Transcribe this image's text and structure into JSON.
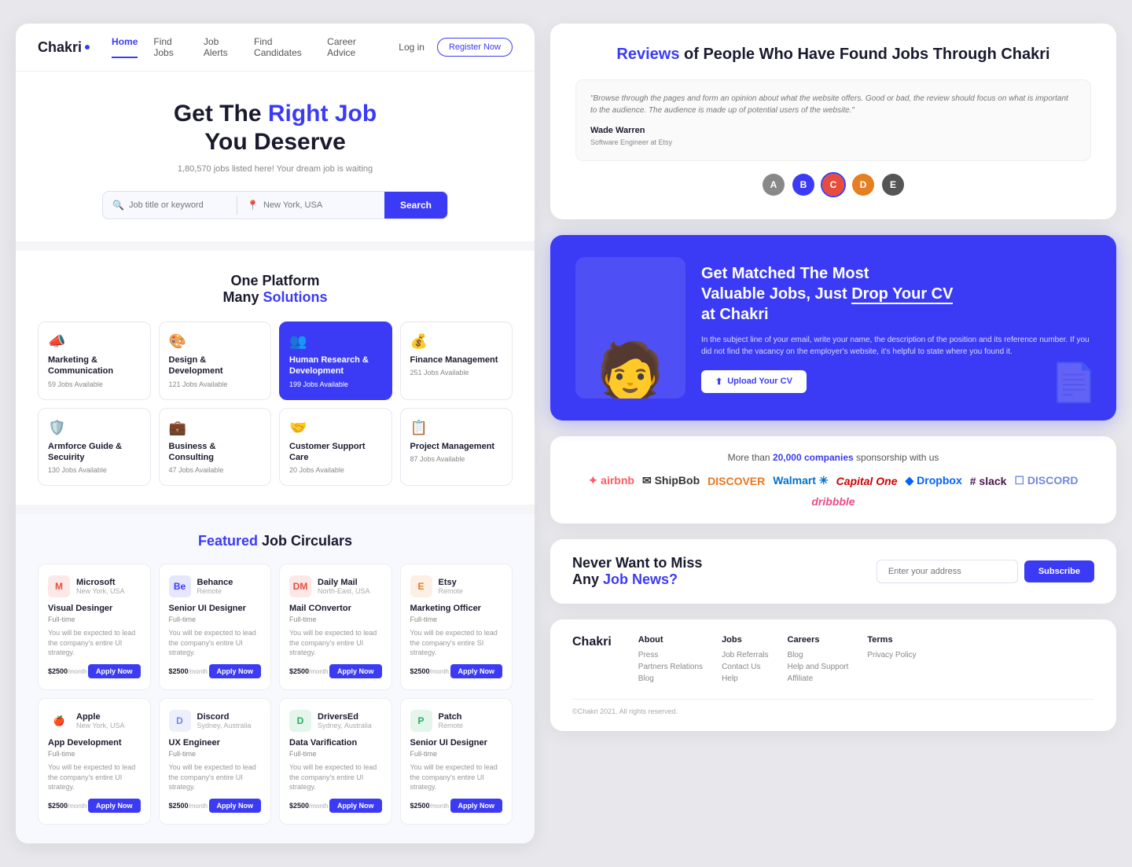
{
  "left": {
    "navbar": {
      "logo": "Chakri",
      "links": [
        {
          "label": "Home",
          "active": true
        },
        {
          "label": "Find Jobs"
        },
        {
          "label": "Job Alerts"
        },
        {
          "label": "Find Candidates"
        },
        {
          "label": "Career Advice"
        }
      ],
      "login": "Log in",
      "register": "Register Now"
    },
    "hero": {
      "title_plain": "Get The",
      "title_highlight": "Right Job",
      "title_end": "You Deserve",
      "subtitle": "1,80,570 jobs listed here! Your dream job is waiting",
      "search_placeholder": "Job title or keyword",
      "location_placeholder": "New York, USA",
      "search_btn": "Search"
    },
    "platform": {
      "title_plain": "One Platform",
      "title_sub_plain": "Many",
      "title_sub_highlight": "Solutions",
      "categories": [
        {
          "icon": "📣",
          "name": "Marketing & Communication",
          "jobs": "59 Jobs Available"
        },
        {
          "icon": "🎨",
          "name": "Design & Development",
          "jobs": "121 Jobs Available"
        },
        {
          "icon": "👥",
          "name": "Human Research & Development",
          "jobs": "199 Jobs Available",
          "active": true
        },
        {
          "icon": "💰",
          "name": "Finance Management",
          "jobs": "251 Jobs Available"
        },
        {
          "icon": "🛡️",
          "name": "Armforce Guide & Secuirity",
          "jobs": "130 Jobs Available"
        },
        {
          "icon": "💼",
          "name": "Business & Consulting",
          "jobs": "47 Jobs Available"
        },
        {
          "icon": "🤝",
          "name": "Customer Support Care",
          "jobs": "20 Jobs Available"
        },
        {
          "icon": "📋",
          "name": "Project Management",
          "jobs": "87 Jobs Available"
        }
      ]
    },
    "featured": {
      "title_highlight": "Featured",
      "title_plain": "Job Circulars",
      "jobs_row1": [
        {
          "company": "Microsoft",
          "location": "New York, USA",
          "logo_color": "#e74c3c",
          "logo_text": "M",
          "title": "Visual Desinger",
          "type": "Full-time",
          "desc": "You will be expected to lead the company's entire UI strategy.",
          "salary": "$2500",
          "salary_period": "/month"
        },
        {
          "company": "Behance",
          "location": "Remote",
          "logo_color": "#3b3bf5",
          "logo_text": "Be",
          "title": "Senior UI Designer",
          "type": "Full-time",
          "desc": "You will be expected to lead the company's entire UI strategy.",
          "salary": "$2500",
          "salary_period": "/month"
        },
        {
          "company": "Daily Mail",
          "location": "North-East, USA",
          "logo_color": "#e74c3c",
          "logo_text": "DM",
          "title": "Mail COnvertor",
          "type": "Full-time",
          "desc": "You will be expected to lead the company's entire UI strategy.",
          "salary": "$2500",
          "salary_period": "/month"
        },
        {
          "company": "Etsy",
          "location": "Remote",
          "logo_color": "#e67e22",
          "logo_text": "E",
          "title": "Marketing Officer",
          "type": "Full-time",
          "desc": "You will be expected to lead the company's entire SI strategy.",
          "salary": "$2500",
          "salary_period": "/month"
        }
      ],
      "jobs_row2": [
        {
          "company": "Apple",
          "location": "New York, USA",
          "logo_color": "#555",
          "logo_text": "🍎",
          "title": "App Development",
          "type": "Full-time",
          "desc": "You will be expected to lead the company's entire UI strategy.",
          "salary": "$2500",
          "salary_period": "/month"
        },
        {
          "company": "Discord",
          "location": "Sydney, Australia",
          "logo_color": "#7289da",
          "logo_text": "D",
          "title": "UX Engineer",
          "type": "Full-time",
          "desc": "You will be expected to lead the company's entire UI strategy.",
          "salary": "$2500",
          "salary_period": "/month"
        },
        {
          "company": "DriversEd",
          "location": "Sydney, Australia",
          "logo_color": "#27ae60",
          "logo_text": "D",
          "title": "Data Varification",
          "type": "Full-time",
          "desc": "You will be expected to lead the company's entire UI strategy.",
          "salary": "$2500",
          "salary_period": "/month"
        },
        {
          "company": "Patch",
          "location": "Remote",
          "logo_color": "#27ae60",
          "logo_text": "P",
          "title": "Senior UI Designer",
          "type": "Full-time",
          "desc": "You will be expected to lead the company's entire UI strategy.",
          "salary": "$2500",
          "salary_period": "/month"
        }
      ]
    }
  },
  "right": {
    "reviews": {
      "title_highlight": "Reviews",
      "title_plain": "of People Who Have Found Jobs Through Chakri",
      "review": {
        "quote": "\"Browse through the pages and form an opinion about what the website offers. Good or bad, the review should focus on what is important to the audience. The audience is made up of potential users of the website.\"",
        "name": "Wade Warren",
        "role": "Software Engineer at Etsy"
      },
      "avatars": [
        {
          "color": "#888",
          "text": "A"
        },
        {
          "color": "#3b3bf5",
          "text": "B"
        },
        {
          "color": "#e74c3c",
          "text": "C",
          "active": true
        },
        {
          "color": "#e67e22",
          "text": "D"
        },
        {
          "color": "#555",
          "text": "E"
        }
      ]
    },
    "cv_drop": {
      "title_line1": "Get Matched The Most",
      "title_line2": "Valuable Jobs, Just",
      "title_highlight": "Drop Your CV",
      "title_line3": "at Chakri",
      "desc": "In the subject line of your email, write your name, the description of the position and its reference number. If you did not find the vacancy on the employer's website, it's helpful to state where you found it.",
      "upload_btn": "Upload Your CV"
    },
    "companies": {
      "title_plain": "More than",
      "title_highlight": "20,000 companies",
      "title_end": "sponsorship with us",
      "logos": [
        {
          "name": "airbnb",
          "icon": "✦",
          "color": "#FF5A5F"
        },
        {
          "name": "ShipBob",
          "icon": "✉",
          "color": "#333"
        },
        {
          "name": "DISCOVER",
          "color": "#e87722"
        },
        {
          "name": "Walmart ✳",
          "color": "#0071CE"
        },
        {
          "name": "Capital One",
          "color": "#cc0000"
        },
        {
          "name": "Dropbox",
          "icon": "◆",
          "color": "#0061FF"
        },
        {
          "name": "slack",
          "icon": "#",
          "color": "#4A154B"
        },
        {
          "name": "DISCORD",
          "color": "#7289DA"
        },
        {
          "name": "dribbble",
          "color": "#EA4C89"
        }
      ]
    },
    "newsletter": {
      "title_plain1": "Never Want to Miss",
      "title_plain2": "Any",
      "title_highlight": "Job News?",
      "input_placeholder": "Enter your address",
      "subscribe_btn": "Subscribe"
    },
    "footer": {
      "logo": "Chakri",
      "cols": [
        {
          "heading": "About",
          "links": [
            "Press",
            "Partners Relations",
            "Blog"
          ]
        },
        {
          "heading": "Jobs",
          "links": [
            "Job Referrals",
            "Contact Us",
            "Help"
          ]
        },
        {
          "heading": "Careers",
          "links": [
            "Blog",
            "Help and Support",
            "Affiliate"
          ]
        },
        {
          "heading": "Terms",
          "links": [
            "Privacy Policy"
          ]
        }
      ],
      "copyright": "©Chakri 2021. All rights reserved."
    }
  }
}
